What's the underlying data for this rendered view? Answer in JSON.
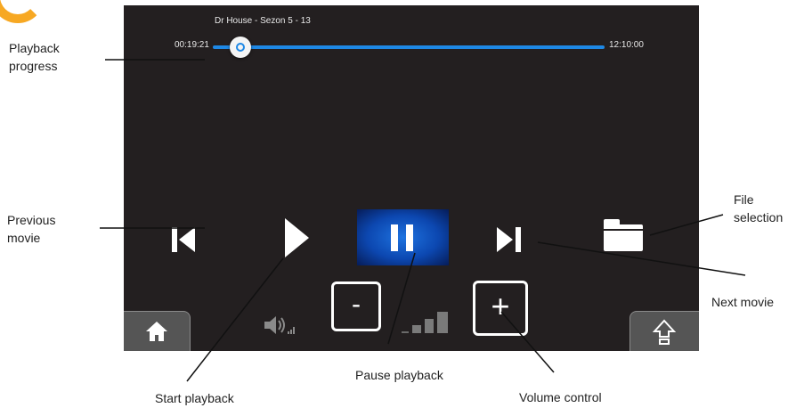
{
  "player": {
    "title": "Dr House - Sezon 5 - 13",
    "elapsed": "00:19:21",
    "total": "12:10:00",
    "progress_fraction": 0.07,
    "volume_level_bars": 3
  },
  "controls": {
    "volume_minus": "-",
    "volume_plus": "+"
  },
  "annotations": {
    "playback_progress": [
      "Playback",
      "progress"
    ],
    "previous_movie": [
      "Previous",
      "movie"
    ],
    "file_selection": [
      "File",
      "selection"
    ],
    "next_movie": "Next movie",
    "start_playback": "Start playback",
    "pause_playback": "Pause playback",
    "volume_control": "Volume control"
  },
  "colors": {
    "screen_bg": "#231f20",
    "accent": "#1e88e5",
    "logo": "#f7a823"
  },
  "icons": {
    "prev": "skip-back-icon",
    "play": "play-icon",
    "pause": "pause-icon",
    "next": "skip-forward-icon",
    "files": "folder-icon",
    "home": "home-icon",
    "eject": "eject-icon",
    "speaker": "speaker-icon"
  }
}
